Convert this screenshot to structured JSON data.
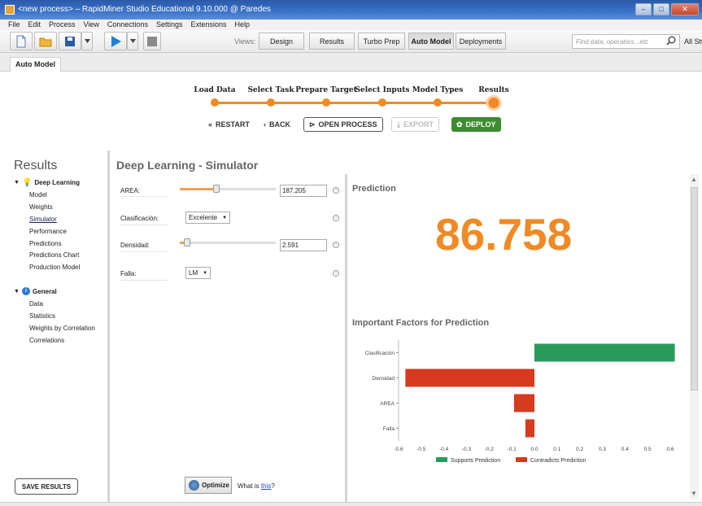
{
  "window": {
    "title": "<new process> – RapidMiner Studio Educational 9.10.000 @ Paredes",
    "controls": [
      "–",
      "□",
      "✕"
    ]
  },
  "menu": [
    "File",
    "Edit",
    "Process",
    "View",
    "Connections",
    "Settings",
    "Extensions",
    "Help"
  ],
  "toolbar": {
    "views_label": "Views:",
    "views": [
      "Design",
      "Results",
      "Turbo Prep",
      "Auto Model",
      "Deployments"
    ],
    "active_view": "Auto Model",
    "search_placeholder": "Find data, operators...etc",
    "all_studio": "All Studio"
  },
  "panel_tab": "Auto Model",
  "wizard": {
    "steps": [
      "Load Data",
      "Select Task",
      "Prepare Target",
      "Select Inputs",
      "Model Types",
      "Results"
    ],
    "current_step": "Results",
    "buttons": {
      "restart": "RESTART",
      "back": "BACK",
      "open_process": "OPEN PROCESS",
      "export": "EXPORT",
      "deploy": "DEPLOY"
    },
    "colors": {
      "accent": "#f08a24",
      "deploy": "#3c8d2e"
    }
  },
  "results": {
    "title": "Results",
    "groups": [
      {
        "label": "Deep Learning",
        "icon": "lightbulb-icon",
        "items": [
          "Model",
          "Weights",
          "Simulator",
          "Performance",
          "Predictions",
          "Predictions Chart",
          "Production Model"
        ]
      },
      {
        "label": "General",
        "icon": "info-icon",
        "items": [
          "Data",
          "Statistics",
          "Weights by Correlation",
          "Correlations"
        ]
      }
    ],
    "selected_item": "Simulator",
    "save_button": "SAVE RESULTS"
  },
  "simulator": {
    "title": "Deep Learning - Simulator",
    "inputs": {
      "area": {
        "label": "AREA:",
        "value": "187.205",
        "slider_fraction": 0.38
      },
      "clasificacion": {
        "label": "Clasificación:",
        "value": "Excelente"
      },
      "densidad": {
        "label": "Densidad:",
        "value": "2.591",
        "slider_fraction": 0.08
      },
      "falla": {
        "label": "Falla:",
        "value": "LM"
      }
    },
    "optimize_button": "Optimize",
    "whatis_prefix": "What is ",
    "whatis_link": "this",
    "whatis_suffix": "?"
  },
  "prediction": {
    "label": "Prediction",
    "value": "86.758",
    "value_color": "#f08a24"
  },
  "factors": {
    "title": "Important Factors for Prediction"
  },
  "chart_data": {
    "type": "bar",
    "orientation": "horizontal",
    "title": "Important Factors for Prediction",
    "categories": [
      "Clasificación",
      "Densidad",
      "AREA",
      "Falla"
    ],
    "values": [
      0.62,
      -0.57,
      -0.09,
      -0.04
    ],
    "xlim": [
      -0.6,
      0.6
    ],
    "xticks": [
      "-0.6",
      "-0.5",
      "-0.4",
      "-0.3",
      "-0.2",
      "-0.1",
      "0.0",
      "0.1",
      "0.2",
      "0.3",
      "0.4",
      "0.5",
      "0.6"
    ],
    "legend": [
      {
        "name": "Supports Prediction",
        "color": "#2a9a5b"
      },
      {
        "name": "Contradicts Prediction",
        "color": "#d63a1f"
      }
    ],
    "legend_placement": "bottom"
  }
}
